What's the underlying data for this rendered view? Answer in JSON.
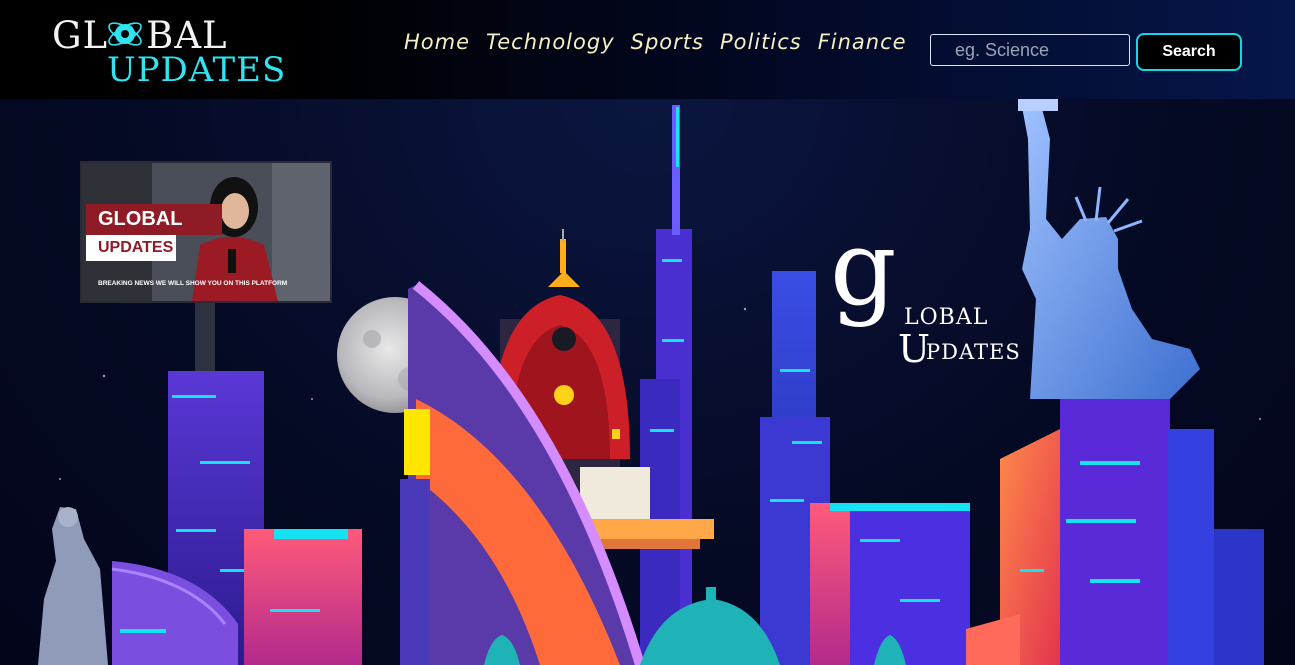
{
  "header": {
    "logo": {
      "word1_left": "GL",
      "word1_right": "BAL",
      "word2": "UPDATES"
    },
    "nav": [
      {
        "label": "Home"
      },
      {
        "label": "Technology"
      },
      {
        "label": "Sports"
      },
      {
        "label": "Politics"
      },
      {
        "label": "Finance"
      }
    ],
    "search": {
      "placeholder": "eg. Science",
      "value": "",
      "button_label": "Search"
    }
  },
  "hero": {
    "billboard": {
      "tag_line1": "GLOBAL",
      "tag_line2": "UPDATES",
      "ticker": "BREAKING NEWS WE WILL SHOW YOU ON THIS PLATFORM"
    },
    "emblem": {
      "big_letter": "g",
      "line1": "LOBAL",
      "line2_initial": "U",
      "line2": "PDATES"
    }
  },
  "colors": {
    "accent_cyan": "#19d6e6",
    "nav_text": "#f6efc4",
    "logo_cyan": "#2fe4f0",
    "brand_red": "#8e1b25"
  },
  "icons": [
    "globe-icon"
  ]
}
